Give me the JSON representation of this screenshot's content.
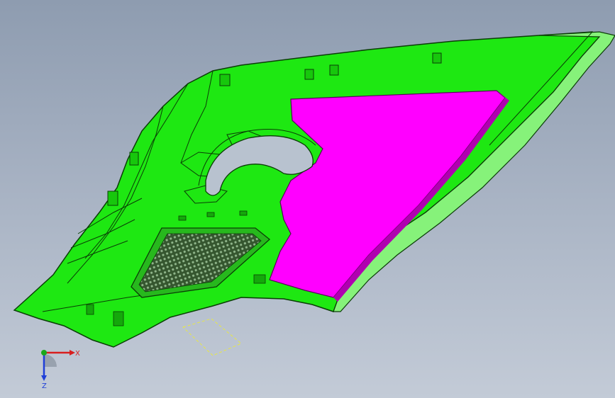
{
  "viewport": {
    "background_top": "#8e9cb0",
    "background_bottom": "#c3cbd7"
  },
  "model": {
    "part_color": "#1ee812",
    "part_highlight": "#7cf070",
    "edge_color": "#0a3d06",
    "accent_panel_color": "#ff00ff",
    "accent_panel_shadow": "#b000b0",
    "grille_color": "#2f4f2a",
    "selection_box_color": "#e8e844"
  },
  "triad": {
    "x_label": "X",
    "z_label": "Z",
    "x_color": "#d81e1e",
    "y_color": "#1aa81a",
    "z_color": "#1f3fd8"
  }
}
